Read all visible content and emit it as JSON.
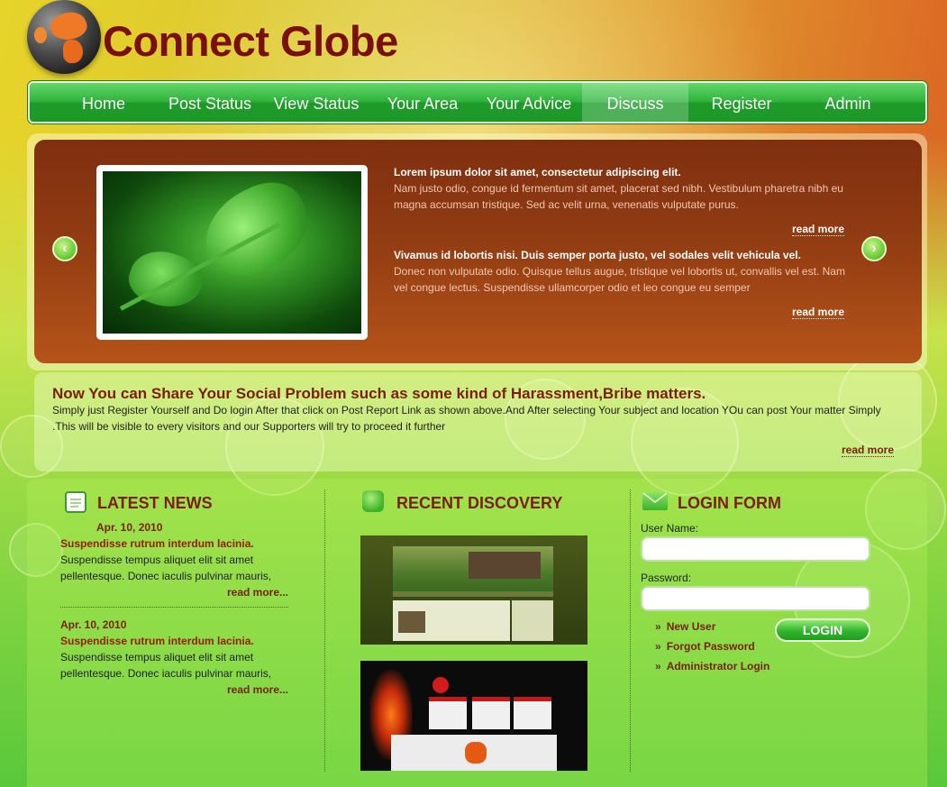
{
  "site": {
    "title": "Connect Globe"
  },
  "nav": {
    "items": [
      {
        "label": "Home"
      },
      {
        "label": "Post Status"
      },
      {
        "label": "View Status"
      },
      {
        "label": "Your Area"
      },
      {
        "label": "Your Advice"
      },
      {
        "label": "Discuss"
      },
      {
        "label": "Register"
      },
      {
        "label": "Admin"
      }
    ],
    "active_index": 5
  },
  "slider": {
    "prev_icon": "left-arrow-icon",
    "next_icon": "right-arrow-icon",
    "items": [
      {
        "title": "Lorem ipsum dolor sit amet, consectetur adipiscing elit.",
        "body": "Nam justo odio, congue id fermentum sit amet, placerat sed nibh. Vestibulum pharetra nibh eu magna accumsan tristique. Sed ac velit urna, venenatis vulputate purus.",
        "more": "read more"
      },
      {
        "title": "Vivamus id lobortis nisi. Duis semper porta justo, vel sodales velit vehicula vel.",
        "body": "Donec non vulputate odio. Quisque tellus augue, tristique vel lobortis ut, convallis vel est. Nam vel congue lectus. Suspendisse ullamcorper odio et leo congue eu semper",
        "more": "read more"
      }
    ]
  },
  "intro": {
    "title": "Now You can Share Your Social Problem such as some kind of Harassment,Bribe matters.",
    "text": "Simply just Register Yourself and Do login After that click on Post Report Link as shown above.And After selecting Your subject and location YOu can post Your matter Simply .This will be visible to every visitors and our Supporters will try to proceed it further",
    "more": "read more"
  },
  "latest_news": {
    "title": "LATEST NEWS",
    "icon": "notepad-icon",
    "items": [
      {
        "date": "Apr. 10, 2010",
        "headline": "Suspendisse rutrum interdum lacinia.",
        "body": "Suspendisse tempus aliquet elit sit amet pellentesque. Donec iaculis pulvinar mauris,",
        "more": "read more..."
      },
      {
        "date": "Apr. 10, 2010",
        "headline": "Suspendisse rutrum interdum lacinia.",
        "body": "Suspendisse tempus aliquet elit sit amet pellentesque. Donec iaculis pulvinar mauris,",
        "more": "read more..."
      }
    ]
  },
  "recent_discovery": {
    "title": "RECENT DISCOVERY",
    "icon": "chat-bubble-icon"
  },
  "login_form": {
    "title": "LOGIN FORM",
    "icon": "envelope-icon",
    "username_label": "User Name:",
    "username_value": "",
    "password_label": "Password:",
    "password_value": "",
    "button_label": "LOGIN",
    "links": [
      "New User",
      "Forgot Password",
      "Administrator Login"
    ]
  },
  "colors": {
    "title_red": "#7a0f0f",
    "nav_green": "#2fb33b",
    "slider_brown": "#8f3a12"
  }
}
